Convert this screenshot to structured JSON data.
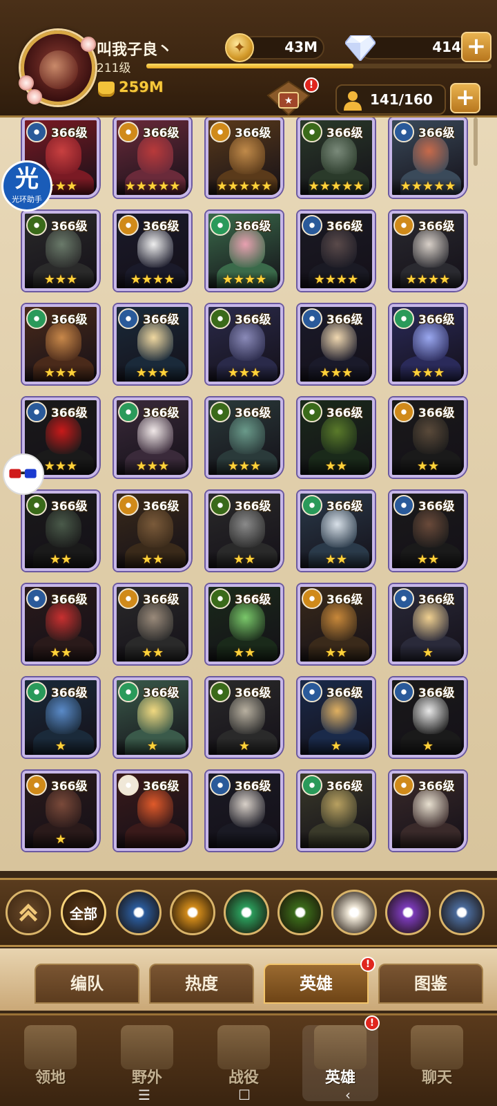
{
  "player": {
    "name": "叫我子良丶",
    "level": "211级",
    "xp_fraction": 0.6,
    "power": "259M"
  },
  "resources": {
    "gold": "43M",
    "diamonds": "414",
    "plus": "+"
  },
  "hero_count": "141/160",
  "badge": "!",
  "helper": {
    "big": "光",
    "small": "光环助手"
  },
  "heroes": [
    {
      "level": "366级",
      "stars": "★★★",
      "faction": "lightbearer",
      "colors": [
        "#7a1a24",
        "#c84040"
      ]
    },
    {
      "level": "366级",
      "stars": "★★★★★",
      "faction": "mauler",
      "colors": [
        "#6a2a3a",
        "#b83a3a"
      ]
    },
    {
      "level": "366级",
      "stars": "★★★★★",
      "faction": "mauler",
      "colors": [
        "#5a3a1a",
        "#c08a4a"
      ]
    },
    {
      "level": "366级",
      "stars": "★★★★★",
      "faction": "graveborn",
      "colors": [
        "#2a3a2a",
        "#7a8a7a"
      ]
    },
    {
      "level": "366级",
      "stars": "★★★★★",
      "faction": "lightbearer",
      "colors": [
        "#3a4a5a",
        "#c86a4a"
      ]
    },
    {
      "level": "366级",
      "stars": "★★★",
      "faction": "graveborn",
      "colors": [
        "#2a2a2a",
        "#6a7a6a"
      ]
    },
    {
      "level": "366级",
      "stars": "★★★★",
      "faction": "mauler",
      "colors": [
        "#1a1a2a",
        "#eeeeee"
      ]
    },
    {
      "level": "366级",
      "stars": "★★★★",
      "faction": "wilder",
      "colors": [
        "#3a6a4a",
        "#e8a0b0"
      ]
    },
    {
      "level": "366级",
      "stars": "★★★★",
      "faction": "lightbearer",
      "colors": [
        "#1a1a24",
        "#5a4a4a"
      ]
    },
    {
      "level": "366级",
      "stars": "★★★★",
      "faction": "mauler",
      "colors": [
        "#2a2a30",
        "#d8d0c8"
      ]
    },
    {
      "level": "366级",
      "stars": "★★★",
      "faction": "wilder",
      "colors": [
        "#4a2a1a",
        "#c8884a"
      ]
    },
    {
      "level": "366级",
      "stars": "★★★",
      "faction": "lightbearer",
      "colors": [
        "#1a2a3a",
        "#f0d8a0"
      ]
    },
    {
      "level": "366级",
      "stars": "★★★",
      "faction": "graveborn",
      "colors": [
        "#2a2a4a",
        "#8a8ab8"
      ]
    },
    {
      "level": "366级",
      "stars": "★★★",
      "faction": "lightbearer",
      "colors": [
        "#1a1a2a",
        "#f0d8b0"
      ]
    },
    {
      "level": "366级",
      "stars": "★★★",
      "faction": "wilder",
      "colors": [
        "#2a2a5a",
        "#9aa8f0"
      ]
    },
    {
      "level": "366级",
      "stars": "★★★",
      "faction": "lightbearer",
      "colors": [
        "#1a1a1a",
        "#c81a1a"
      ]
    },
    {
      "level": "366级",
      "stars": "★★★",
      "faction": "wilder",
      "colors": [
        "#3a2a3a",
        "#f0e8e8"
      ]
    },
    {
      "level": "366级",
      "stars": "★★★",
      "faction": "graveborn",
      "colors": [
        "#2a3a3a",
        "#6a9a8a"
      ]
    },
    {
      "level": "366级",
      "stars": "★★",
      "faction": "graveborn",
      "colors": [
        "#1a2a1a",
        "#5a7a2a"
      ]
    },
    {
      "level": "366级",
      "stars": "★★",
      "faction": "mauler",
      "colors": [
        "#1a1a1a",
        "#5a4a3a"
      ]
    },
    {
      "level": "366级",
      "stars": "★★",
      "faction": "graveborn",
      "colors": [
        "#1a1a1a",
        "#4a5a4a"
      ]
    },
    {
      "level": "366级",
      "stars": "★★",
      "faction": "mauler",
      "colors": [
        "#3a2a1a",
        "#7a5a3a"
      ]
    },
    {
      "level": "366级",
      "stars": "★★",
      "faction": "graveborn",
      "colors": [
        "#2a2a2a",
        "#8a8a8a"
      ]
    },
    {
      "level": "366级",
      "stars": "★★",
      "faction": "wilder",
      "colors": [
        "#2a3a4a",
        "#d8e0e8"
      ]
    },
    {
      "level": "366级",
      "stars": "★★",
      "faction": "lightbearer",
      "colors": [
        "#1a1a1a",
        "#6a4a3a"
      ]
    },
    {
      "level": "366级",
      "stars": "★★",
      "faction": "lightbearer",
      "colors": [
        "#2a1a1a",
        "#c83030"
      ]
    },
    {
      "level": "366级",
      "stars": "★★",
      "faction": "mauler",
      "colors": [
        "#2a2a2a",
        "#9a8a7a"
      ]
    },
    {
      "level": "366级",
      "stars": "★★",
      "faction": "graveborn",
      "colors": [
        "#1a2a1a",
        "#7ac86a"
      ]
    },
    {
      "level": "366级",
      "stars": "★★",
      "faction": "mauler",
      "colors": [
        "#3a2a1a",
        "#c8883a"
      ]
    },
    {
      "level": "366级",
      "stars": "★",
      "faction": "lightbearer",
      "colors": [
        "#2a2a3a",
        "#f0d090"
      ]
    },
    {
      "level": "366级",
      "stars": "★",
      "faction": "wilder",
      "colors": [
        "#1a2a3a",
        "#5a8ac8"
      ]
    },
    {
      "level": "366级",
      "stars": "★",
      "faction": "wilder",
      "colors": [
        "#3a5a4a",
        "#f0d880"
      ]
    },
    {
      "level": "366级",
      "stars": "★",
      "faction": "graveborn",
      "colors": [
        "#2a2a2a",
        "#b8b0a0"
      ]
    },
    {
      "level": "366级",
      "stars": "★",
      "faction": "lightbearer",
      "colors": [
        "#1a2a4a",
        "#e0b060"
      ]
    },
    {
      "level": "366级",
      "stars": "★",
      "faction": "lightbearer",
      "colors": [
        "#1a1a1a",
        "#e8e8e8"
      ]
    },
    {
      "level": "366级",
      "stars": "★",
      "faction": "mauler",
      "colors": [
        "#2a1a1a",
        "#7a4a3a"
      ]
    },
    {
      "level": "366级",
      "stars": "",
      "faction": "celestial",
      "colors": [
        "#3a1a1a",
        "#e05a2a"
      ]
    },
    {
      "level": "366级",
      "stars": "",
      "faction": "lightbearer",
      "colors": [
        "#1a1a24",
        "#d8d0c8"
      ]
    },
    {
      "level": "366级",
      "stars": "",
      "faction": "wilder",
      "colors": [
        "#3a3a2a",
        "#b8a060"
      ]
    },
    {
      "level": "366级",
      "stars": "",
      "faction": "mauler",
      "colors": [
        "#3a2a2a",
        "#e8e0d0"
      ]
    }
  ],
  "filters": {
    "collapse": "collapse",
    "all": "全部",
    "factions": [
      "lightbearer",
      "mauler",
      "wilder",
      "graveborn",
      "celestial",
      "hypogean",
      "dimensional"
    ]
  },
  "faction_colors": {
    "lightbearer": "#2a5a9a",
    "mauler": "#d08a1a",
    "wilder": "#2a9a5a",
    "graveborn": "#3a6a1a",
    "celestial": "#f0e8d8",
    "hypogean": "#7a3ab8",
    "dimensional": "#4a6a9a"
  },
  "subtabs": [
    "编队",
    "热度",
    "英雄",
    "图鉴"
  ],
  "active_subtab": 2,
  "nav": [
    "领地",
    "野外",
    "战役",
    "英雄",
    "聊天"
  ],
  "active_nav": 3,
  "sys_nav": [
    "☰",
    "☐",
    "‹"
  ]
}
